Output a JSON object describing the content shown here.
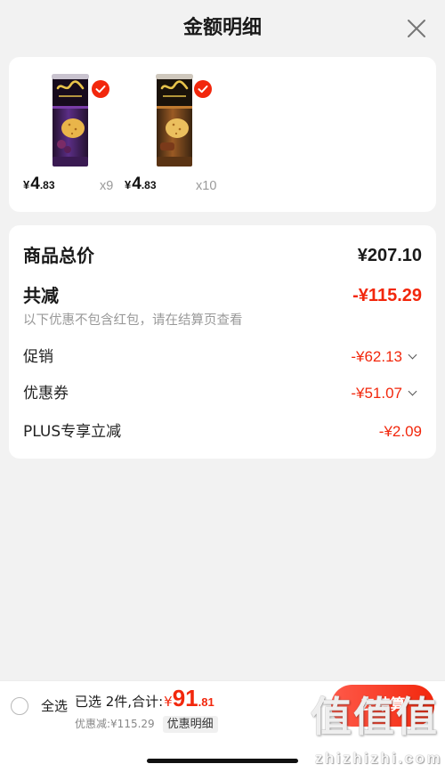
{
  "header": {
    "title": "金额明细"
  },
  "products": [
    {
      "price_symbol": "¥",
      "price_int": "4",
      "price_dec": ".83",
      "quantity": "x9",
      "selected": true
    },
    {
      "price_symbol": "¥",
      "price_int": "4",
      "price_dec": ".83",
      "quantity": "x10",
      "selected": true
    }
  ],
  "summary": {
    "total_label": "商品总价",
    "total_value": "¥207.10",
    "reduction_label": "共减",
    "reduction_value": "-¥115.29",
    "reduction_note": "以下优惠不包含红包，请在结算页查看",
    "items": [
      {
        "label": "促销",
        "value": "-¥62.13",
        "expandable": true
      },
      {
        "label": "优惠券",
        "value": "-¥51.07",
        "expandable": true
      },
      {
        "label": "PLUS专享立减",
        "value": "-¥2.09",
        "expandable": false
      }
    ]
  },
  "footer": {
    "select_all_label": "全选",
    "select_all_checked": false,
    "selected_summary": "已选 2件,合计:",
    "total_symbol": "¥",
    "total_int": "91",
    "total_dec": ".81",
    "discount_text": "优惠减:¥115.29",
    "details_tag": "优惠明细",
    "checkout_label": "去结算"
  },
  "watermark": {
    "glyphs": "值值值",
    "site": "zhizhizhi.com"
  },
  "icons": {
    "close": "close-icon",
    "selected_badge": "check-circle-icon",
    "expand": "chevron-down-icon",
    "select_all": "radio-circle-icon"
  },
  "colors": {
    "accent": "#f2270c",
    "page_background": "#f2f2f2",
    "card_background": "#ffffff",
    "text_primary": "#1a1a1a",
    "text_secondary": "#999999"
  }
}
